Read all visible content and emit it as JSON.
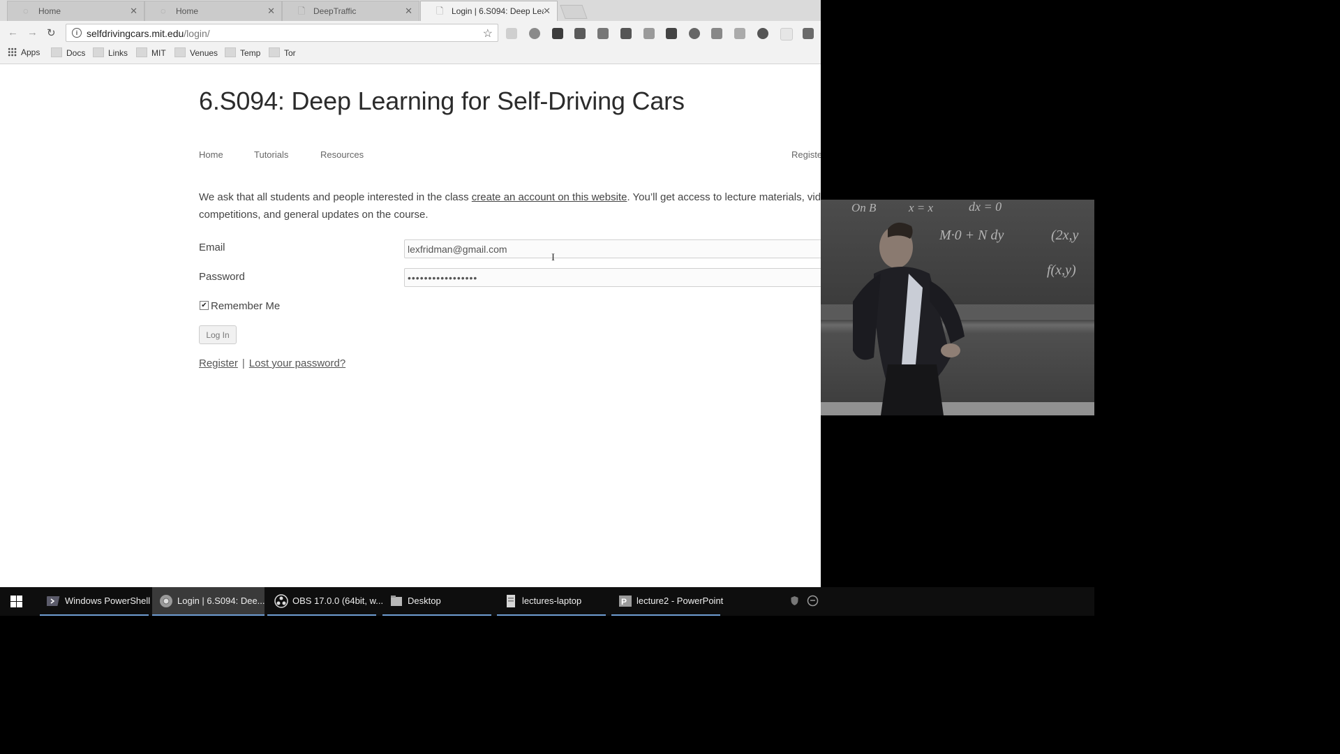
{
  "browser": {
    "tabs": [
      {
        "title": "Home"
      },
      {
        "title": "Home"
      },
      {
        "title": "DeepTraffic"
      },
      {
        "title": "Login | 6.S094: Deep Lea"
      }
    ],
    "address": {
      "host": "selfdrivingcars.mit.edu",
      "path": "/login/"
    },
    "bookmarks": [
      "Apps",
      "Docs",
      "Links",
      "MIT",
      "Venues",
      "Temp",
      "Tor"
    ]
  },
  "page": {
    "title": "6.S094: Deep Learning for Self-Driving Cars",
    "nav": [
      "Home",
      "Tutorials",
      "Resources"
    ],
    "nav_right": "Registe",
    "intro_before": "We ask that all students and people interested in the class ",
    "intro_link": "create an account on this website",
    "intro_after": ". You’ll get access to lecture materials, vide",
    "intro_line2": "competitions, and general updates on the course.",
    "form": {
      "email_label": "Email",
      "email_value": "lexfridman@gmail.com",
      "password_label": "Password",
      "password_value": "•••••••••••••••••",
      "remember_label": "Remember Me",
      "remember_checked": true,
      "login_label": "Log In"
    },
    "register_link": "Register",
    "separator": "|",
    "lost_password_link": "Lost your password?"
  },
  "webcam": {
    "board_texts": [
      "On B",
      "x = x",
      "dx = 0",
      "M·0 + N dy",
      "(2x,y",
      "f(x,y)"
    ]
  },
  "taskbar": {
    "items": [
      {
        "label": "Windows PowerShell",
        "icon": "powershell-icon",
        "active": false
      },
      {
        "label": "Login | 6.S094: Dee...",
        "icon": "chrome-icon",
        "active": true
      },
      {
        "label": "OBS 17.0.0 (64bit, w...",
        "icon": "obs-icon",
        "active": false
      },
      {
        "label": "Desktop",
        "icon": "folder-icon",
        "active": false
      },
      {
        "label": "lectures-laptop",
        "icon": "document-icon",
        "active": false
      },
      {
        "label": "lecture2 - PowerPoint",
        "icon": "powerpoint-icon",
        "active": false
      }
    ]
  },
  "colors": {
    "taskbar_accent": "#6f9ed3",
    "taskbar_bg": "#0e0e0e"
  }
}
